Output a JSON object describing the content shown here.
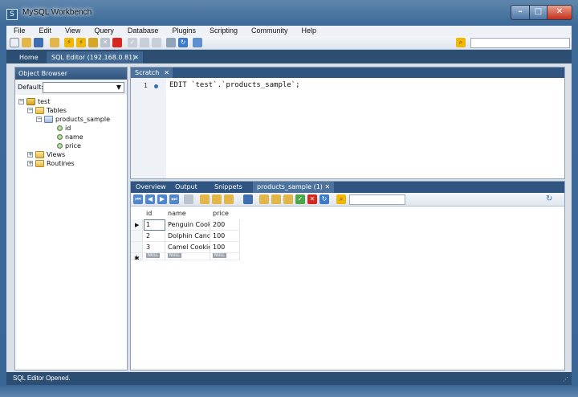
{
  "window": {
    "title": "MySQL Workbench",
    "app_icon": "sql-workbench-icon"
  },
  "menu": [
    "File",
    "Edit",
    "View",
    "Query",
    "Database",
    "Plugins",
    "Scripting",
    "Community",
    "Help"
  ],
  "tabs": [
    {
      "label": "Home"
    },
    {
      "label": "SQL Editor (192.168.0.81)",
      "close": "✕"
    }
  ],
  "object_browser": {
    "title": "Object Browser",
    "default_label": "Default:",
    "default_value": "",
    "tree": {
      "schema": "test",
      "tables": "Tables",
      "table": "products_sample",
      "columns": [
        "id",
        "name",
        "price"
      ],
      "views": "Views",
      "routines": "Routines"
    }
  },
  "editor": {
    "tab_label": "Scratch",
    "tab_close": "✕",
    "line_number": "1",
    "code": "EDIT `test`.`products_sample`;"
  },
  "result": {
    "tabs": [
      "Overview",
      "Output",
      "Snippets"
    ],
    "active_tab": "products_sample (1)",
    "active_tab_close": "✕",
    "columns": [
      "id",
      "name",
      "price"
    ],
    "rows": [
      [
        "1",
        "Penguin Cookie",
        "200"
      ],
      [
        "2",
        "Dolphin Candy",
        "100"
      ],
      [
        "3",
        "Camel Cookie",
        "100"
      ]
    ],
    "new_row_marker": "✱",
    "null_tag": "NULL"
  },
  "status": {
    "text": "SQL Editor Opened."
  },
  "colors": {
    "frame": "#3d6a99",
    "panel_header": "#2f5580",
    "status_bar": "#2d4e73"
  }
}
